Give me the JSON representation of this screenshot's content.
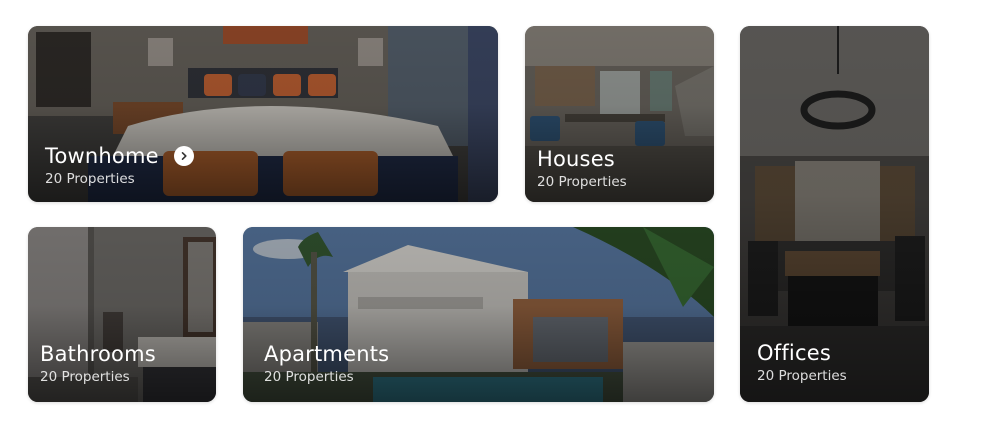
{
  "cards": [
    {
      "title": "Townhome",
      "subtitle": "20 Properties",
      "has_arrow": true
    },
    {
      "title": "Houses",
      "subtitle": "20 Properties"
    },
    {
      "title": "Offices",
      "subtitle": "20 Properties"
    },
    {
      "title": "Bathrooms",
      "subtitle": "20 Properties"
    },
    {
      "title": "Apartments",
      "subtitle": "20 Properties"
    }
  ],
  "icons": {
    "arrow": "chevron-right-icon"
  }
}
